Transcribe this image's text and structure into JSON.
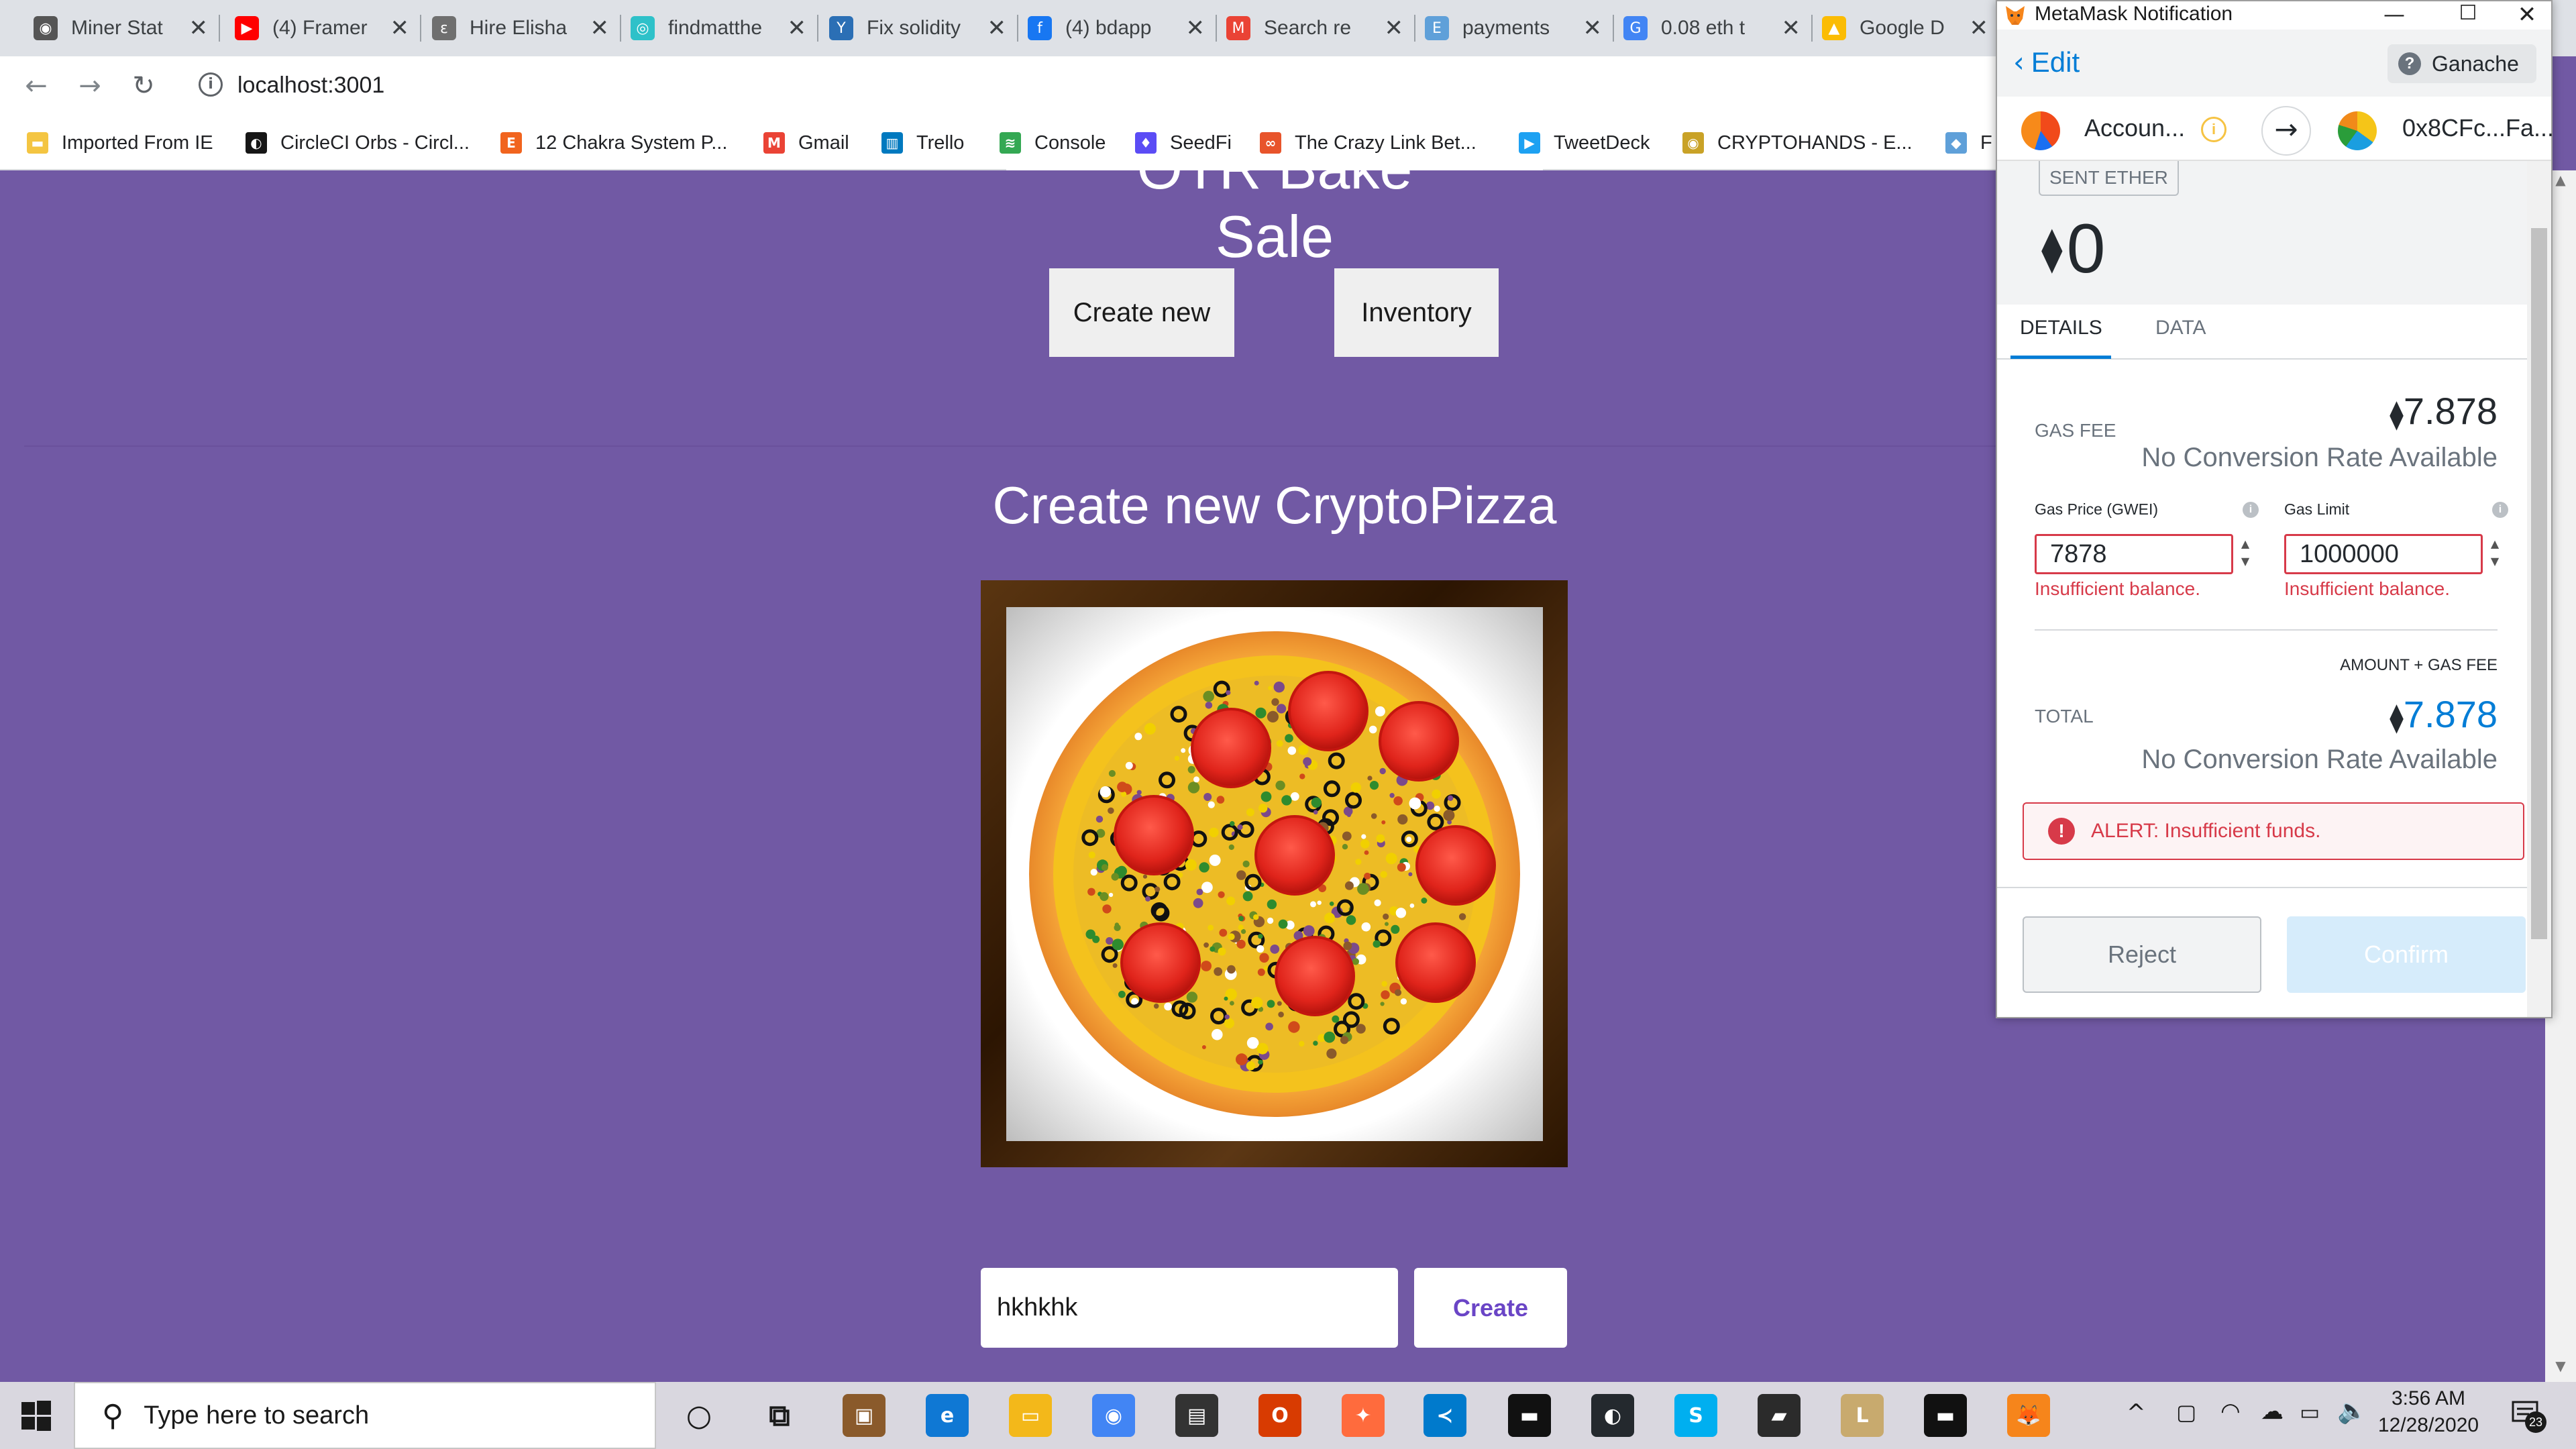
{
  "browser": {
    "tabs": [
      {
        "title": "Miner Stat",
        "icon": "miner-icon",
        "color": "#555555"
      },
      {
        "title": "(4) Framer",
        "icon": "youtube-icon",
        "color": "#ff0000"
      },
      {
        "title": "Hire Elisha",
        "icon": "upwork-icon",
        "color": "#6f6f6f"
      },
      {
        "title": "findmatthe",
        "icon": "findmatthew-icon",
        "color": "#2ec1c9"
      },
      {
        "title": "Fix solidity",
        "icon": "solidity-icon",
        "color": "#2b6fb5"
      },
      {
        "title": "(4) bdapp",
        "icon": "facebook-icon",
        "color": "#1877f2"
      },
      {
        "title": "Search re",
        "icon": "gmail-icon",
        "color": "#ea4335"
      },
      {
        "title": "payments",
        "icon": "etherscan-icon",
        "color": "#5fa0d9"
      },
      {
        "title": "0.08 eth t",
        "icon": "google-icon",
        "color": "#4285f4"
      },
      {
        "title": "Google D",
        "icon": "google-drive-icon",
        "color": "#fbbc04"
      }
    ],
    "url": "localhost:3001",
    "bookmarks": [
      {
        "label": "Imported From IE",
        "icon": "folder-icon",
        "color": "#f4c542"
      },
      {
        "label": "CircleCI Orbs - Circl...",
        "icon": "circleci-icon",
        "color": "#161616"
      },
      {
        "label": "12 Chakra System P...",
        "icon": "etsy-icon",
        "color": "#f1641e"
      },
      {
        "label": "Gmail",
        "icon": "gmail-icon",
        "color": "#ea4335"
      },
      {
        "label": "Trello",
        "icon": "trello-icon",
        "color": "#0079bf"
      },
      {
        "label": "Console",
        "icon": "console-icon",
        "color": "#34a853"
      },
      {
        "label": "SeedFi",
        "icon": "seedfi-icon",
        "color": "#5b4cf5"
      },
      {
        "label": "The Crazy Link Bet...",
        "icon": "crazylink-icon",
        "color": "#e8542b"
      },
      {
        "label": "TweetDeck",
        "icon": "tweetdeck-icon",
        "color": "#1da1f2"
      },
      {
        "label": "CRYPTOHANDS - E...",
        "icon": "cryptohands-icon",
        "color": "#c9a227"
      },
      {
        "label": "F",
        "icon": "bookmark-icon",
        "color": "#5fa0d9"
      }
    ]
  },
  "page": {
    "header_title": "OTR Bake Sale",
    "create_new_label": "Create new",
    "inventory_label": "Inventory",
    "create_heading": "Create new CryptoPizza",
    "name_input_value": "hkhkhk",
    "create_button_label": "Create"
  },
  "metamask": {
    "window_title": "MetaMask Notification",
    "edit_label": "Edit",
    "network": "Ganache",
    "account_name": "Accoun...",
    "to_address": "0x8CFc...Fa...",
    "sent_badge": "SENT ETHER",
    "amount": "0",
    "tab_details": "DETAILS",
    "tab_data": "DATA",
    "gas_fee_label": "GAS FEE",
    "gas_fee_value": "7.878",
    "no_conversion": "No Conversion Rate Available",
    "gas_price_label": "Gas Price (GWEI)",
    "gas_limit_label": "Gas Limit",
    "gas_price_value": "7878",
    "gas_limit_value": "1000000",
    "insufficient_balance": "Insufficient balance.",
    "amount_gas_label": "AMOUNT + GAS FEE",
    "total_label": "TOTAL",
    "total_value": "7.878",
    "alert_text": "ALERT: Insufficient funds.",
    "reject_label": "Reject",
    "confirm_label": "Confirm",
    "accent_color": "#037dd6",
    "error_color": "#d73a49"
  },
  "taskbar": {
    "search_placeholder": "Type here to search",
    "time": "3:56 AM",
    "date": "12/28/2020",
    "notification_count": "23",
    "apps": [
      {
        "name": "cortana-icon",
        "color": "#d9d7df"
      },
      {
        "name": "task-view-icon",
        "color": "#d9d7df"
      },
      {
        "name": "app-box-icon",
        "color": "#8a5a2b"
      },
      {
        "name": "edge-icon",
        "color": "#0f78d4"
      },
      {
        "name": "file-explorer-icon",
        "color": "#f3b81a"
      },
      {
        "name": "chrome-icon",
        "color": "#4285f4"
      },
      {
        "name": "store-icon",
        "color": "#333333"
      },
      {
        "name": "office-icon",
        "color": "#d83b01"
      },
      {
        "name": "gaming-icon",
        "color": "#ff6b3d"
      },
      {
        "name": "vscode-icon",
        "color": "#007acc"
      },
      {
        "name": "terminal-icon",
        "color": "#111111"
      },
      {
        "name": "github-icon",
        "color": "#24292e"
      },
      {
        "name": "skype-icon",
        "color": "#00aff0"
      },
      {
        "name": "sticky-notes-icon",
        "color": "#2b2b2b"
      },
      {
        "name": "league-icon",
        "color": "#c8aa6e"
      },
      {
        "name": "cmd-icon",
        "color": "#111111"
      },
      {
        "name": "metamask-icon",
        "color": "#f6851b"
      }
    ]
  }
}
